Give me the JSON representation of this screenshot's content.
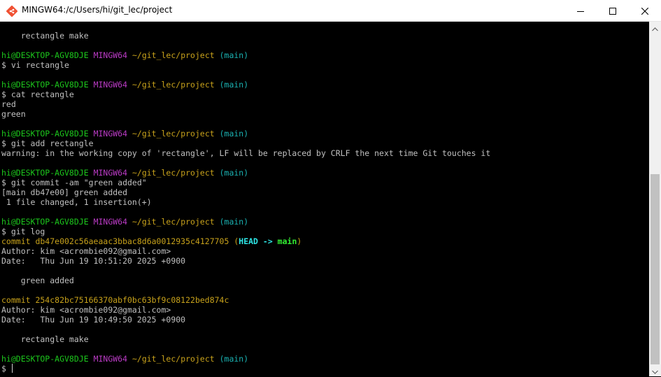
{
  "window": {
    "title": "MINGW64:/c/Users/hi/git_lec/project",
    "icon": "git-bash-icon",
    "buttons": [
      "minimize-icon",
      "maximize-icon",
      "close-icon"
    ]
  },
  "colors": {
    "user_host": "#1cc71c",
    "mingw": "#bb3bc6",
    "path": "#c8a21b",
    "branch": "#1ab3b3",
    "head": "#2ee6e6",
    "main_ref": "#32ee32",
    "text": "#c0c0c0"
  },
  "prompt": {
    "user_host": "hi@DESKTOP-AGV8DJE",
    "env": "MINGW64",
    "path": "~/git_lec/project",
    "branch": "(main)"
  },
  "lines": [
    {
      "type": "text",
      "text": "    rectangle make"
    },
    {
      "type": "blank"
    },
    {
      "type": "prompt"
    },
    {
      "type": "text",
      "text": "$ vi rectangle"
    },
    {
      "type": "blank"
    },
    {
      "type": "prompt"
    },
    {
      "type": "text",
      "text": "$ cat rectangle"
    },
    {
      "type": "text",
      "text": "red"
    },
    {
      "type": "text",
      "text": "green"
    },
    {
      "type": "blank"
    },
    {
      "type": "prompt"
    },
    {
      "type": "text",
      "text": "$ git add rectangle"
    },
    {
      "type": "text",
      "text": "warning: in the working copy of 'rectangle', LF will be replaced by CRLF the next time Git touches it"
    },
    {
      "type": "blank"
    },
    {
      "type": "prompt"
    },
    {
      "type": "text",
      "text": "$ git commit -am \"green added\""
    },
    {
      "type": "text",
      "text": "[main db47e00] green added"
    },
    {
      "type": "text",
      "text": " 1 file changed, 1 insertion(+)"
    },
    {
      "type": "blank"
    },
    {
      "type": "prompt"
    },
    {
      "type": "text",
      "text": "$ git log"
    },
    {
      "type": "commit",
      "text": "commit db47e002c56aeaac3bbac8d6a0012935c4127705",
      "decor": {
        "open": " (",
        "head": "HEAD -> ",
        "ref": "main",
        "close": ")"
      }
    },
    {
      "type": "text",
      "text": "Author: kim <acrombie092@gmail.com>"
    },
    {
      "type": "text",
      "text": "Date:   Thu Jun 19 10:51:20 2025 +0900"
    },
    {
      "type": "blank"
    },
    {
      "type": "text",
      "text": "    green added"
    },
    {
      "type": "blank"
    },
    {
      "type": "commit",
      "text": "commit 254c82bc75166370abf0bc63bf9c08122bed874c"
    },
    {
      "type": "text",
      "text": "Author: kim <acrombie092@gmail.com>"
    },
    {
      "type": "text",
      "text": "Date:   Thu Jun 19 10:49:50 2025 +0900"
    },
    {
      "type": "blank"
    },
    {
      "type": "text",
      "text": "    rectangle make"
    },
    {
      "type": "blank"
    },
    {
      "type": "prompt"
    },
    {
      "type": "cursorline",
      "text": "$ "
    }
  ]
}
